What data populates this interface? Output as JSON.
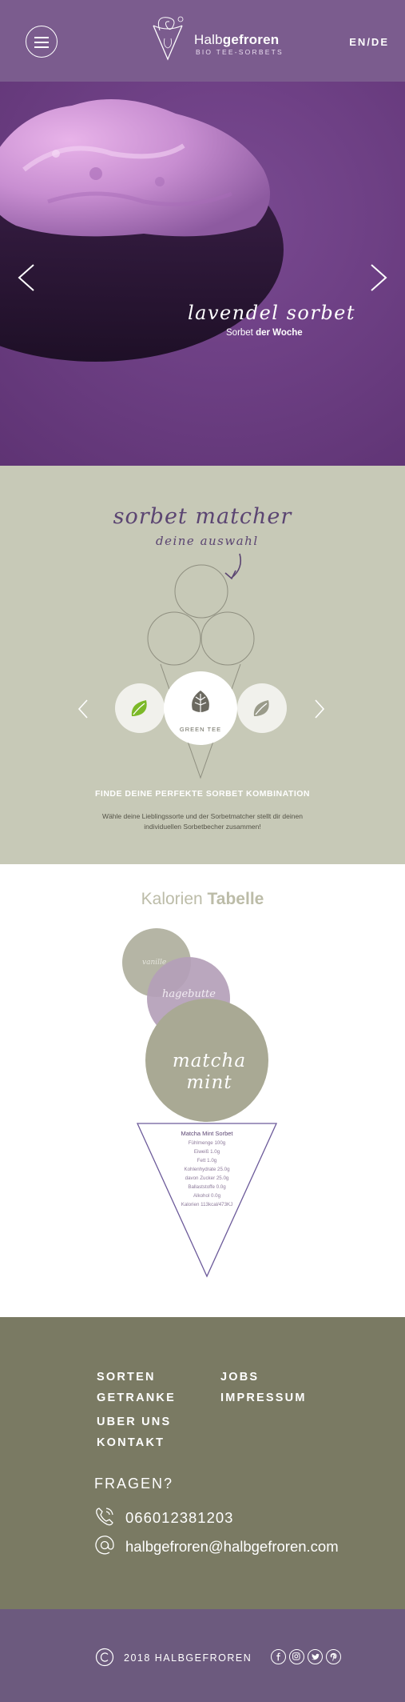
{
  "header": {
    "brand_light": "Halb",
    "brand_bold": "gefroren",
    "brand_sub": "BIO TEE-SORBETS",
    "lang": "EN/DE",
    "menu_icon": "hamburger-menu-icon"
  },
  "hero": {
    "title": "lavendel sorbet",
    "sub_light": "Sorbet ",
    "sub_bold": "der Woche",
    "prev_icon": "chevron-left-icon",
    "next_icon": "chevron-right-icon"
  },
  "matcher": {
    "title": "sorbet matcher",
    "subtitle": "deine auswahl",
    "selected_label": "GREEN TEE",
    "cta": "FINDE DEINE PERFEKTE SORBET KOMBINATION",
    "description": "Wähle deine Lieblingssorte und der Sorbetmatcher stellt dir deinen individuellen Sorbetbecher zusammen!"
  },
  "kalorien": {
    "title_light": "Kalorien ",
    "title_bold": "Tabelle",
    "scoops": {
      "top": "vanille",
      "middle": "hagebutte",
      "main_line1": "matcha",
      "main_line2": "mint"
    },
    "table_title": "Matcha Mint Sorbet",
    "rows": [
      "Fühlmenge 100g",
      "Eiweiß 1.0g",
      "Fett 1.0g",
      "Kohlenhydrate 25.0g",
      "davon Zucker 25.0g",
      "Ballaststoffe 0.0g",
      "Alkohol 0.0g",
      "Kalorien 113kcal/473KJ"
    ]
  },
  "footer": {
    "nav": {
      "sorten": "SORTEN",
      "getranke": "GETRANKE",
      "jobs": "JOBS",
      "impressum": "IMPRESSUM",
      "ueber": "UBER UNS",
      "kontakt": "KONTAKT"
    },
    "fragen": "FRAGEN?",
    "phone": "066012381203",
    "email": "halbgefroren@halbgefroren.com"
  },
  "bottombar": {
    "copyright": "2018 HALBGEFROREN"
  },
  "colors": {
    "header": "#7b5c8e",
    "hero": "#6b3d80",
    "matcher_bg": "#c7c9b7",
    "footer_bg": "#7a7a63",
    "bottom_bg": "#6c5a7e",
    "accent_purple": "#5b4572",
    "leaf_green": "#7cb928"
  }
}
